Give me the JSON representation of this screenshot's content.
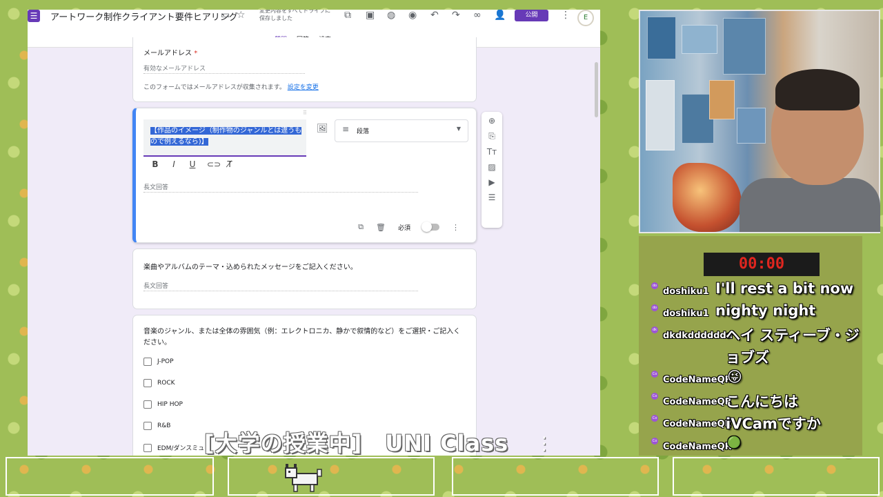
{
  "forms": {
    "title": "アートワーク制作クライアント要件ヒアリング",
    "save_status": "変更内容をすべてドライブに保存しました",
    "publish_label": "公開",
    "avatar_letter": "E",
    "tabs": [
      "質問",
      "回答",
      "設定"
    ],
    "email_card": {
      "title": "メールアドレス",
      "required_mark": "*",
      "placeholder": "有効なメールアドレス",
      "notice": "このフォームではメールアドレスが収集されます。",
      "change_link": "設定を変更"
    },
    "selected_card": {
      "title": "【作品のイメージ（制作物のジャンルとは違うもので例えるなら)】",
      "type": "段落",
      "answer_placeholder": "長文回答",
      "required_label": "必須"
    },
    "card3": {
      "title": "楽曲やアルバムのテーマ・込められたメッセージをご記入ください。",
      "answer_placeholder": "長文回答"
    },
    "card4": {
      "title": "音楽のジャンル、または全体の雰囲気（例：エレクトロニカ、静かで叙情的など）をご選択・ご記入ください。",
      "options": [
        "J-POP",
        "ROCK",
        "HIP HOP",
        "R&B",
        "EDM/ダンスミュ"
      ]
    }
  },
  "chat": {
    "timer": "00:00",
    "messages": [
      {
        "user": "doshiku1",
        "text": "I'll rest a bit now",
        "badge": "do"
      },
      {
        "user": "doshiku1",
        "text": "nighty night",
        "badge": "do"
      },
      {
        "user": "dkdkddddddd",
        "text": "ヘイ スティーブ・ジョブズ",
        "badge": "dk"
      },
      {
        "user": "CodeNameQR",
        "text": "😜",
        "badge": "Co"
      },
      {
        "user": "CodeNameQR",
        "text": "こんにちは",
        "badge": "Co"
      },
      {
        "user": "CodeNameQR",
        "text": "iVCamですか",
        "badge": "Co"
      },
      {
        "user": "CodeNameQR",
        "text": "🟢",
        "badge": "Co"
      }
    ]
  },
  "overlay": {
    "title": "[大学の授業中]　UNI Class",
    "menu": "⋮"
  }
}
